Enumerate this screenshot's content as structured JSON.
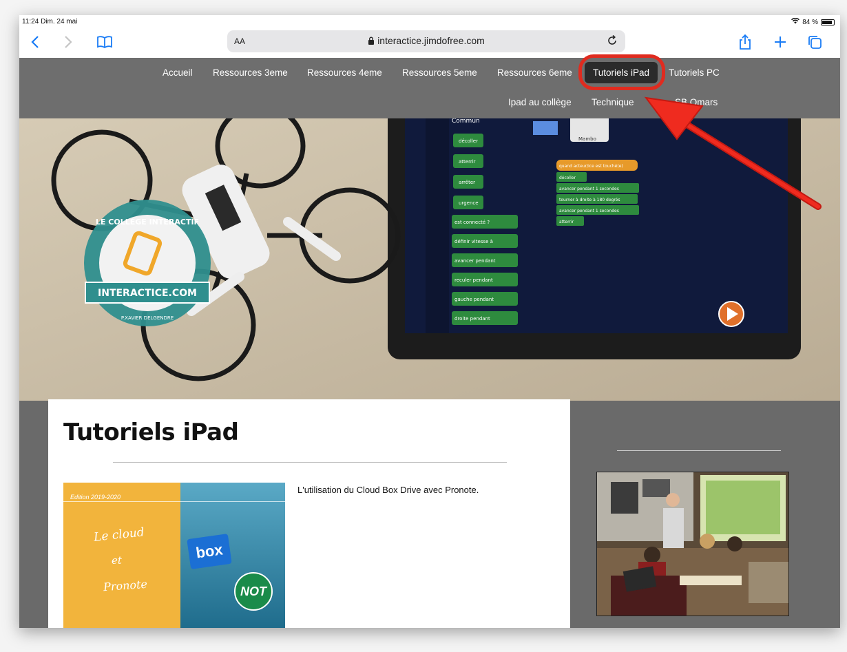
{
  "status": {
    "time": "11:24",
    "date": "Dim. 24 mai",
    "battery": "84 %"
  },
  "browser": {
    "aa_label": "AA",
    "url": "interactice.jimdofree.com"
  },
  "nav": {
    "row1": [
      "Accueil",
      "Ressources 3eme",
      "Ressources 4eme",
      "Ressources 5eme",
      "Ressources 6eme",
      "Tutoriels iPad",
      "Tutoriels PC"
    ],
    "row2": [
      "Ipad au collège",
      "Technique",
      "SB Omars"
    ],
    "active": "Tutoriels iPad"
  },
  "hero": {
    "badge_top": "LE COLLÈGE INTERACTIF",
    "badge_banner": "INTERACTICE.COM",
    "badge_bottom": "P.XAVIER DELGENDRE",
    "app_category": "Commun",
    "sprite_label": "Mambo",
    "code_blocks": [
      "décoller",
      "atterrir",
      "arrêter",
      "urgence",
      "est connecté ?",
      "définir vitesse à",
      "avancer pendant",
      "reculer pendant",
      "gauche pendant",
      "droite pendant"
    ],
    "script_blocks": [
      "quand acteur/ice est touché(e)",
      "décoller",
      "avancer pendant 1 secondes",
      "tourner à droite à 180 degrés",
      "avancer pendant 1 secondes",
      "atterrir"
    ]
  },
  "main": {
    "title": "Tutoriels iPad",
    "article": {
      "edition": "Edition 2019-2020",
      "thumb_text": [
        "Le cloud",
        "et",
        "Pronote"
      ],
      "box_label": "box",
      "not_label": "NOT",
      "description": "L'utilisation du Cloud Box Drive avec Pronote."
    }
  },
  "colors": {
    "nav_bg": "#6e6e6e",
    "active_tab": "#2b2b2b",
    "annotation": "#e02b1f",
    "ios_blue": "#1a7cf5"
  }
}
